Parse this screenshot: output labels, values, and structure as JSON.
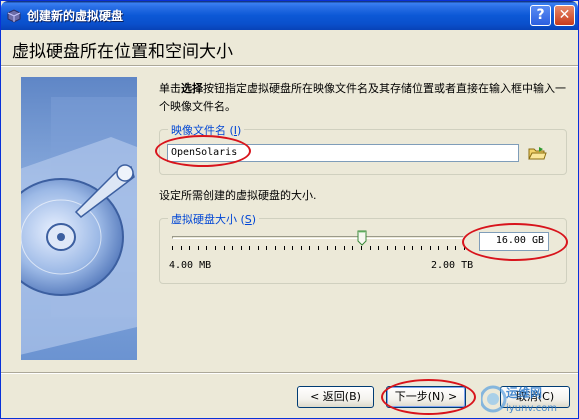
{
  "window": {
    "title": "创建新的虚拟硬盘",
    "app_icon": "virtualbox-icon",
    "buttons": {
      "help": "?",
      "close": "✕"
    }
  },
  "heading": "虚拟硬盘所在位置和空间大小",
  "instructions": {
    "prefix": "单击",
    "bold": "选择",
    "suffix": "按钮指定虚拟硬盘所在映像文件名及其存储位置或者直接在输入框中输入一个映像文件名。"
  },
  "image_file": {
    "legend": "映像文件名 (",
    "legend_key": "I",
    "legend_end": ")",
    "value": "OpenSolaris",
    "browse_icon": "folder-icon"
  },
  "size_description": "设定所需创建的虚拟硬盘的大小.",
  "disk_size": {
    "legend": "虚拟硬盘大小 (",
    "legend_key": "S",
    "legend_end": ")",
    "min_label": "4.00 MB",
    "max_label": "2.00 TB",
    "value": "16.00 GB",
    "slider_position": 0.65
  },
  "buttons": {
    "back": "< 返回(B)",
    "next": "下一步(N) >",
    "cancel": "取消(C)"
  },
  "watermark": {
    "line1": "运维网",
    "line2": "iyunv.com"
  },
  "colors": {
    "title_bar": "#0c58d6",
    "legend_text": "#0046d5",
    "annotation": "#d8141c",
    "window_bg": "#ece9d8"
  }
}
